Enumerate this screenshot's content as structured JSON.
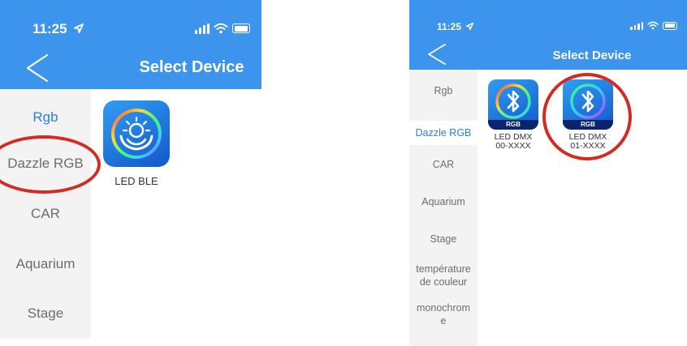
{
  "screenshot_1": {
    "status_bar": {
      "time": "11:25"
    },
    "header": {
      "back_label": "<",
      "title": "Select Device"
    },
    "sidebar": {
      "items": [
        {
          "label": "Rgb",
          "active": true
        },
        {
          "label": "Dazzle RGB",
          "active": false
        },
        {
          "label": "CAR",
          "active": false
        },
        {
          "label": "Aquarium",
          "active": false
        },
        {
          "label": "Stage",
          "active": false
        }
      ]
    },
    "devices": [
      {
        "name": "LED BLE",
        "icon": "sun-hands-icon"
      }
    ]
  },
  "screenshot_2": {
    "status_bar": {
      "time": "11:25"
    },
    "header": {
      "back_label": "<",
      "title": "Select Device"
    },
    "sidebar": {
      "items": [
        {
          "label": "Rgb",
          "active": false
        },
        {
          "label": "Dazzle RGB",
          "active": true
        },
        {
          "label": "CAR",
          "active": false
        },
        {
          "label": "Aquarium",
          "active": false
        },
        {
          "label": "Stage",
          "active": false
        },
        {
          "label": "température de couleur",
          "active": false
        },
        {
          "label": "monochrom e",
          "active": false
        }
      ]
    },
    "devices": [
      {
        "name_line1": "LED DMX",
        "name_line2": "00-XXXX",
        "badge": "RGB",
        "icon": "bluetooth-icon"
      },
      {
        "name_line1": "LED DMX",
        "name_line2": "01-XXXX",
        "badge": "RGB",
        "icon": "bluetooth-icon"
      }
    ]
  },
  "colors": {
    "header_bg": "#3c94ec",
    "active_item": "#2a7ee6",
    "inactive_item": "#6d6d6d",
    "sidebar_bg": "#f3f3f3",
    "highlight_circle": "#d32b22"
  }
}
